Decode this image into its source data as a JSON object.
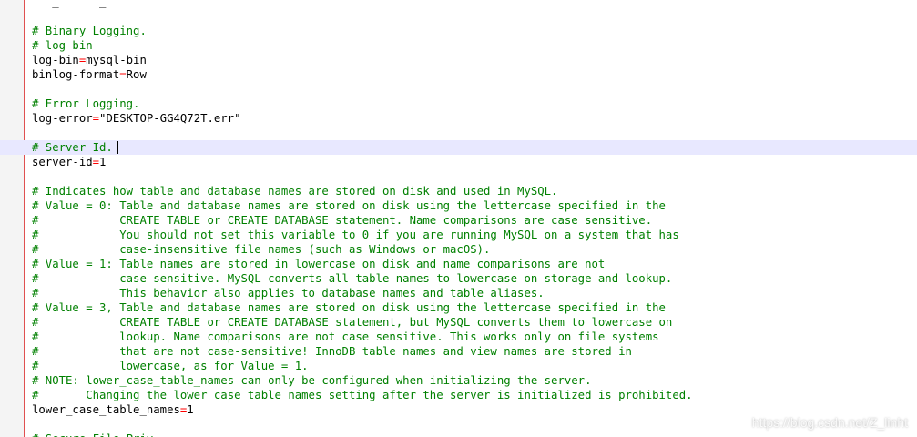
{
  "editor": {
    "lines": [
      {
        "parts": [
          {
            "t": "k",
            "s": "   _      _"
          }
        ]
      },
      {
        "parts": []
      },
      {
        "parts": [
          {
            "t": "c",
            "s": "# Binary Logging."
          }
        ]
      },
      {
        "parts": [
          {
            "t": "c",
            "s": "# log-bin"
          }
        ]
      },
      {
        "parts": [
          {
            "t": "k",
            "s": "log-bin"
          },
          {
            "t": "o",
            "s": "="
          },
          {
            "t": "k",
            "s": "mysql-bin"
          }
        ]
      },
      {
        "parts": [
          {
            "t": "k",
            "s": "binlog-format"
          },
          {
            "t": "o",
            "s": "="
          },
          {
            "t": "k",
            "s": "Row"
          }
        ]
      },
      {
        "parts": []
      },
      {
        "parts": [
          {
            "t": "c",
            "s": "# Error Logging."
          }
        ]
      },
      {
        "parts": [
          {
            "t": "k",
            "s": "log-error"
          },
          {
            "t": "o",
            "s": "="
          },
          {
            "t": "k",
            "s": "\"DESKTOP-GG4Q72T.err\""
          }
        ]
      },
      {
        "parts": []
      },
      {
        "current": true,
        "parts": [
          {
            "t": "c",
            "s": "# Server Id."
          }
        ]
      },
      {
        "parts": [
          {
            "t": "k",
            "s": "server-id"
          },
          {
            "t": "o",
            "s": "="
          },
          {
            "t": "k",
            "s": "1"
          }
        ]
      },
      {
        "parts": []
      },
      {
        "parts": [
          {
            "t": "c",
            "s": "# Indicates how table and database names are stored on disk and used in MySQL."
          }
        ]
      },
      {
        "parts": [
          {
            "t": "c",
            "s": "# Value = 0: Table and database names are stored on disk using the lettercase specified in the"
          }
        ]
      },
      {
        "parts": [
          {
            "t": "c",
            "s": "#            CREATE TABLE or CREATE DATABASE statement. Name comparisons are case sensitive."
          }
        ]
      },
      {
        "parts": [
          {
            "t": "c",
            "s": "#            You should not set this variable to 0 if you are running MySQL on a system that has"
          }
        ]
      },
      {
        "parts": [
          {
            "t": "c",
            "s": "#            case-insensitive file names (such as Windows or macOS)."
          }
        ]
      },
      {
        "parts": [
          {
            "t": "c",
            "s": "# Value = 1: Table names are stored in lowercase on disk and name comparisons are not"
          }
        ]
      },
      {
        "parts": [
          {
            "t": "c",
            "s": "#            case-sensitive. MySQL converts all table names to lowercase on storage and lookup."
          }
        ]
      },
      {
        "parts": [
          {
            "t": "c",
            "s": "#            This behavior also applies to database names and table aliases."
          }
        ]
      },
      {
        "parts": [
          {
            "t": "c",
            "s": "# Value = 3, Table and database names are stored on disk using the lettercase specified in the"
          }
        ]
      },
      {
        "parts": [
          {
            "t": "c",
            "s": "#            CREATE TABLE or CREATE DATABASE statement, but MySQL converts them to lowercase on"
          }
        ]
      },
      {
        "parts": [
          {
            "t": "c",
            "s": "#            lookup. Name comparisons are not case sensitive. This works only on file systems"
          }
        ]
      },
      {
        "parts": [
          {
            "t": "c",
            "s": "#            that are not case-sensitive! InnoDB table names and view names are stored in"
          }
        ]
      },
      {
        "parts": [
          {
            "t": "c",
            "s": "#            lowercase, as for Value = 1."
          }
        ]
      },
      {
        "parts": [
          {
            "t": "c",
            "s": "# NOTE: lower_case_table_names can only be configured when initializing the server."
          }
        ]
      },
      {
        "parts": [
          {
            "t": "c",
            "s": "#       Changing the lower_case_table_names setting after the server is initialized is prohibited."
          }
        ]
      },
      {
        "parts": [
          {
            "t": "k",
            "s": "lower_case_table_names"
          },
          {
            "t": "o",
            "s": "="
          },
          {
            "t": "k",
            "s": "1"
          }
        ]
      },
      {
        "parts": []
      },
      {
        "parts": [
          {
            "t": "c",
            "s": "# Secure File Priv."
          }
        ]
      }
    ],
    "colors": {
      "comment": "#008000",
      "key": "#000000",
      "operator": "#ff0000",
      "current_line": "#e8e8ff",
      "gutter_border": "#e05050"
    }
  },
  "watermark": {
    "text": "https://blog.csdn.net/Z_linht"
  }
}
